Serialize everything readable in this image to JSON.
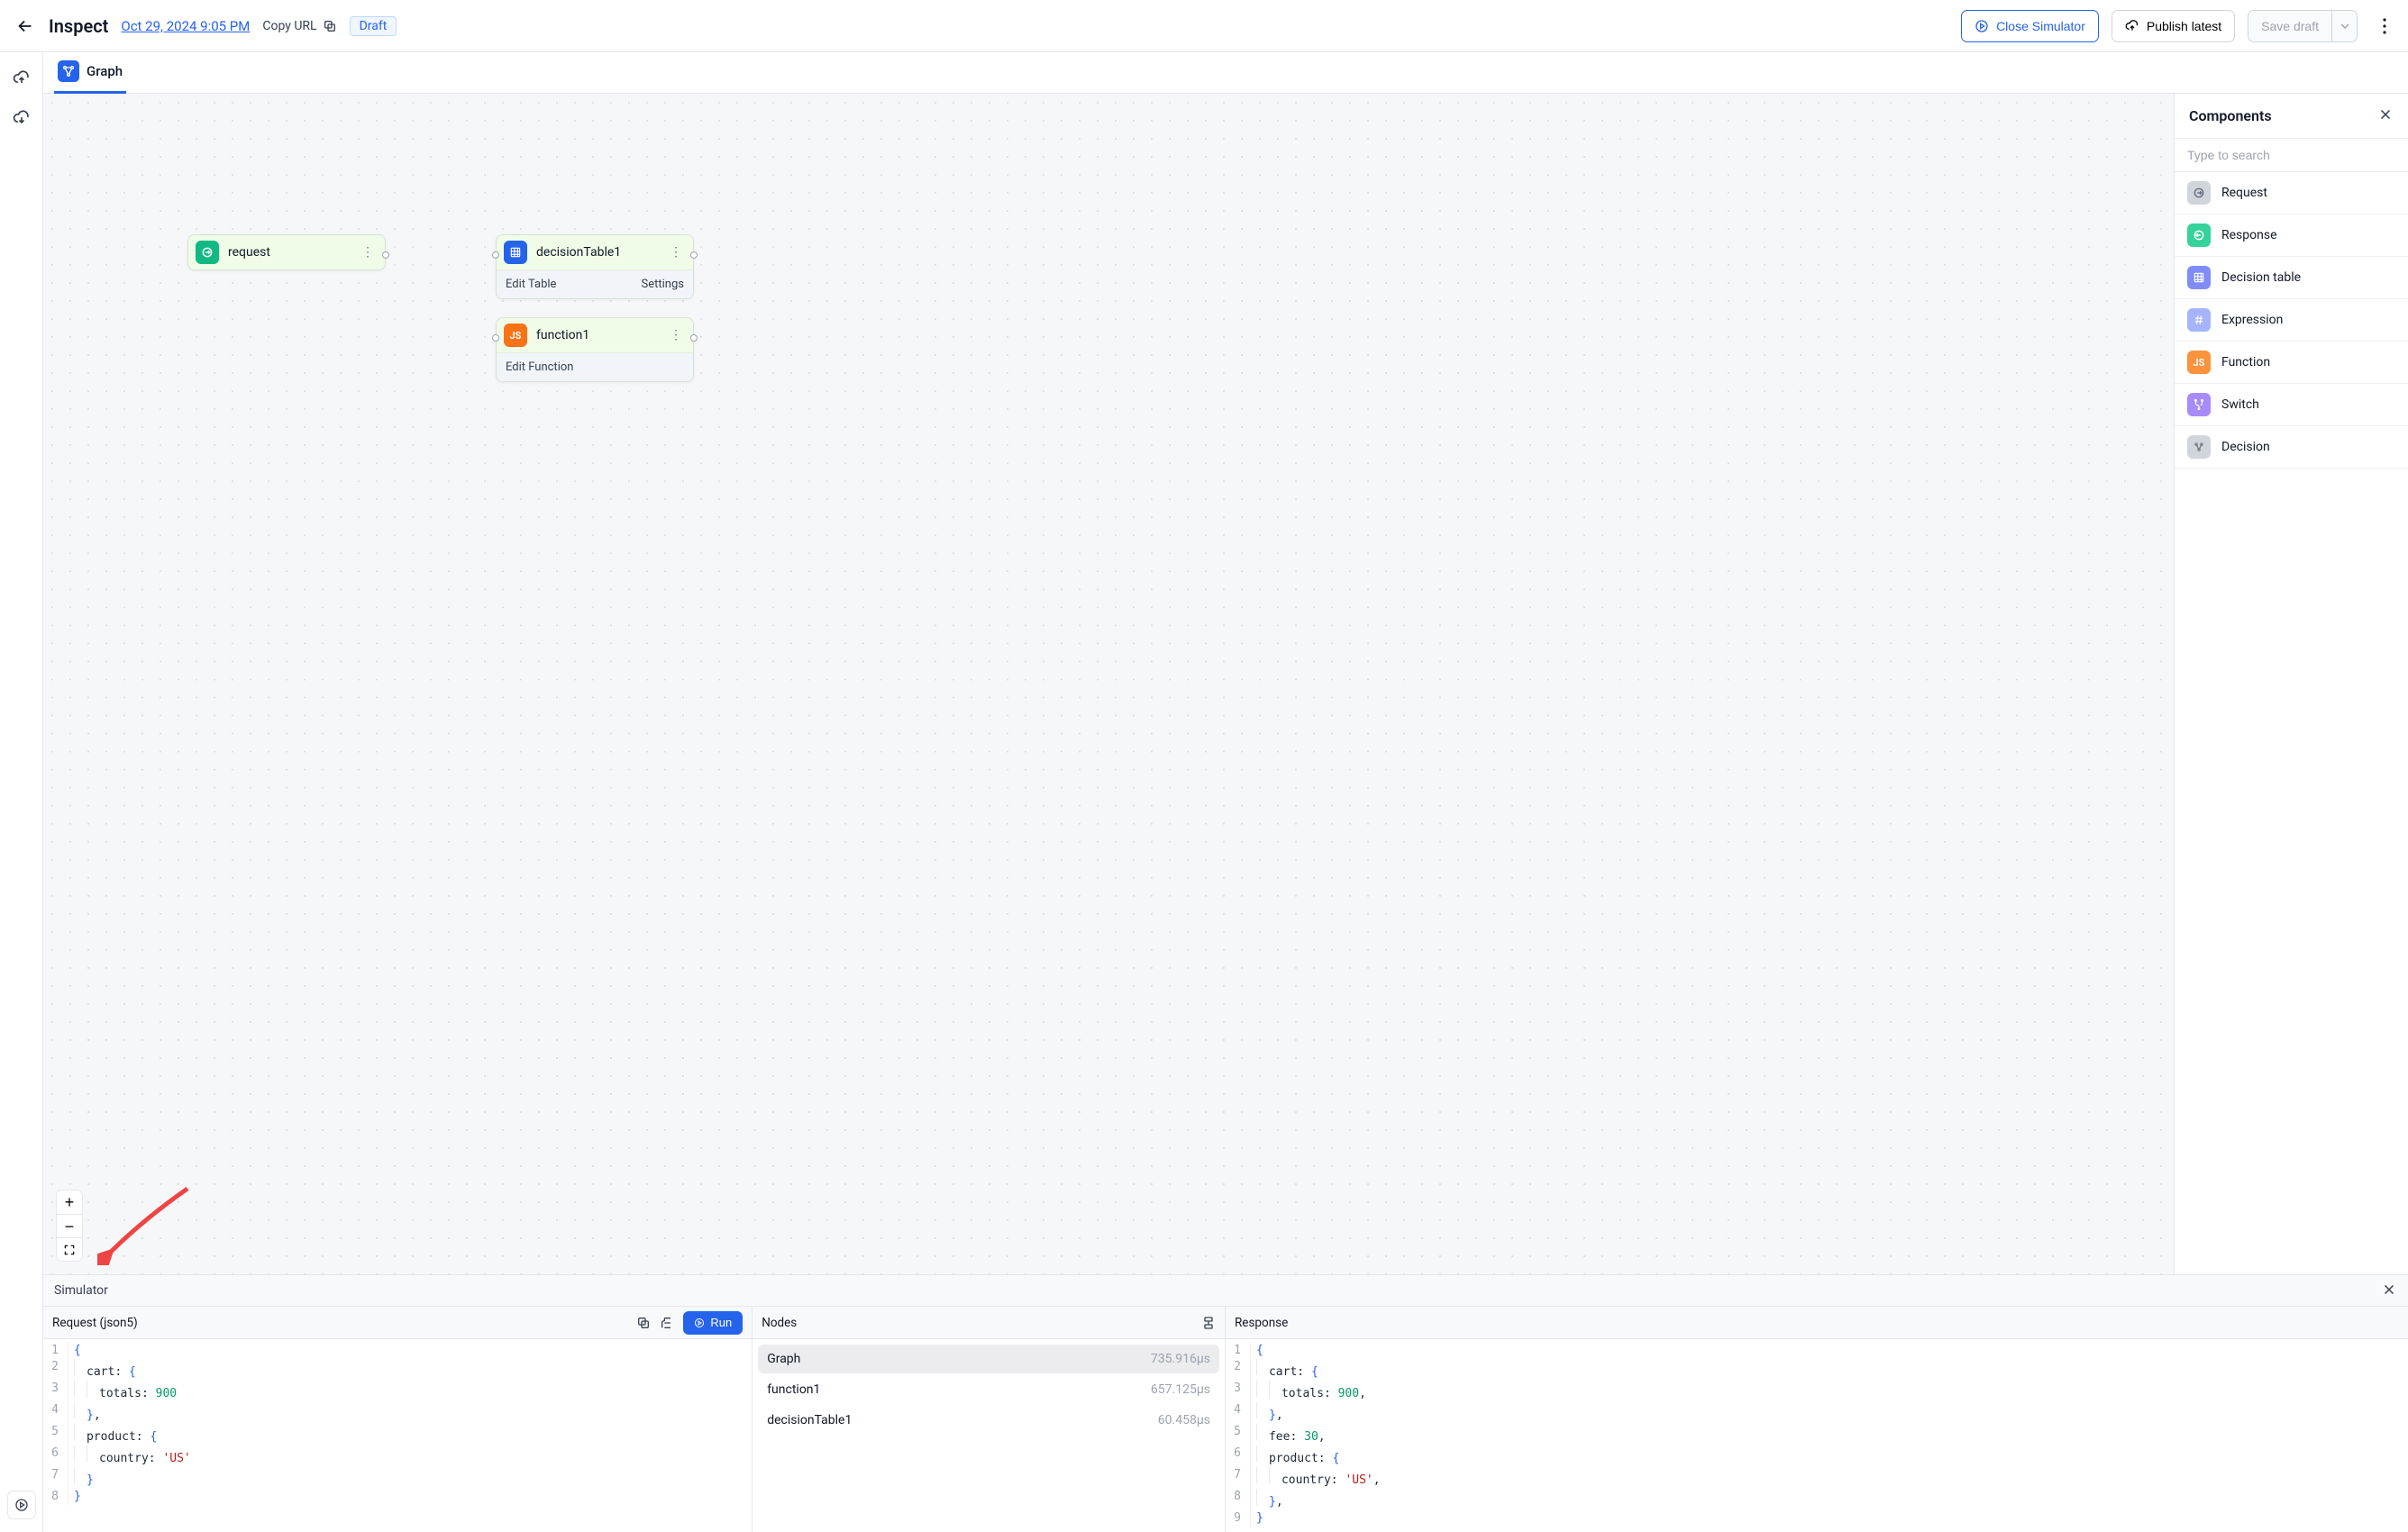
{
  "header": {
    "title": "Inspect",
    "timestamp": "Oct 29, 2024 9:05 PM",
    "copy_url_label": "Copy URL",
    "draft_badge": "Draft",
    "close_sim_label": "Close Simulator",
    "publish_label": "Publish latest",
    "save_draft_label": "Save draft"
  },
  "tabs": {
    "graph": "Graph"
  },
  "canvas": {
    "nodes": {
      "request": {
        "title": "request"
      },
      "decisionTable": {
        "title": "decisionTable1",
        "edit": "Edit Table",
        "settings": "Settings"
      },
      "function": {
        "title": "function1",
        "edit": "Edit Function"
      }
    }
  },
  "components": {
    "title": "Components",
    "search_placeholder": "Type to search",
    "items": [
      {
        "label": "Request",
        "icon": "request",
        "cls": "ci-gray"
      },
      {
        "label": "Response",
        "icon": "response",
        "cls": "ci-teal"
      },
      {
        "label": "Decision table",
        "icon": "table",
        "cls": "ci-indigo"
      },
      {
        "label": "Expression",
        "icon": "hash",
        "cls": "ci-lav"
      },
      {
        "label": "Function",
        "icon": "js",
        "cls": "ci-orange"
      },
      {
        "label": "Switch",
        "icon": "switch",
        "cls": "ci-purple"
      },
      {
        "label": "Decision",
        "icon": "decision",
        "cls": "ci-gray"
      }
    ]
  },
  "simulator": {
    "title": "Simulator",
    "request_title": "Request (json5)",
    "nodes_title": "Nodes",
    "response_title": "Response",
    "run_label": "Run",
    "nodes": [
      {
        "name": "Graph",
        "time": "735.916µs",
        "selected": true
      },
      {
        "name": "function1",
        "time": "657.125µs",
        "selected": false
      },
      {
        "name": "decisionTable1",
        "time": "60.458µs",
        "selected": false
      }
    ],
    "request_json": {
      "cart": {
        "totals": 900
      },
      "product": {
        "country": "US"
      }
    },
    "response_json": {
      "cart": {
        "totals": 900
      },
      "fee": 30,
      "product": {
        "country": "US"
      }
    }
  }
}
